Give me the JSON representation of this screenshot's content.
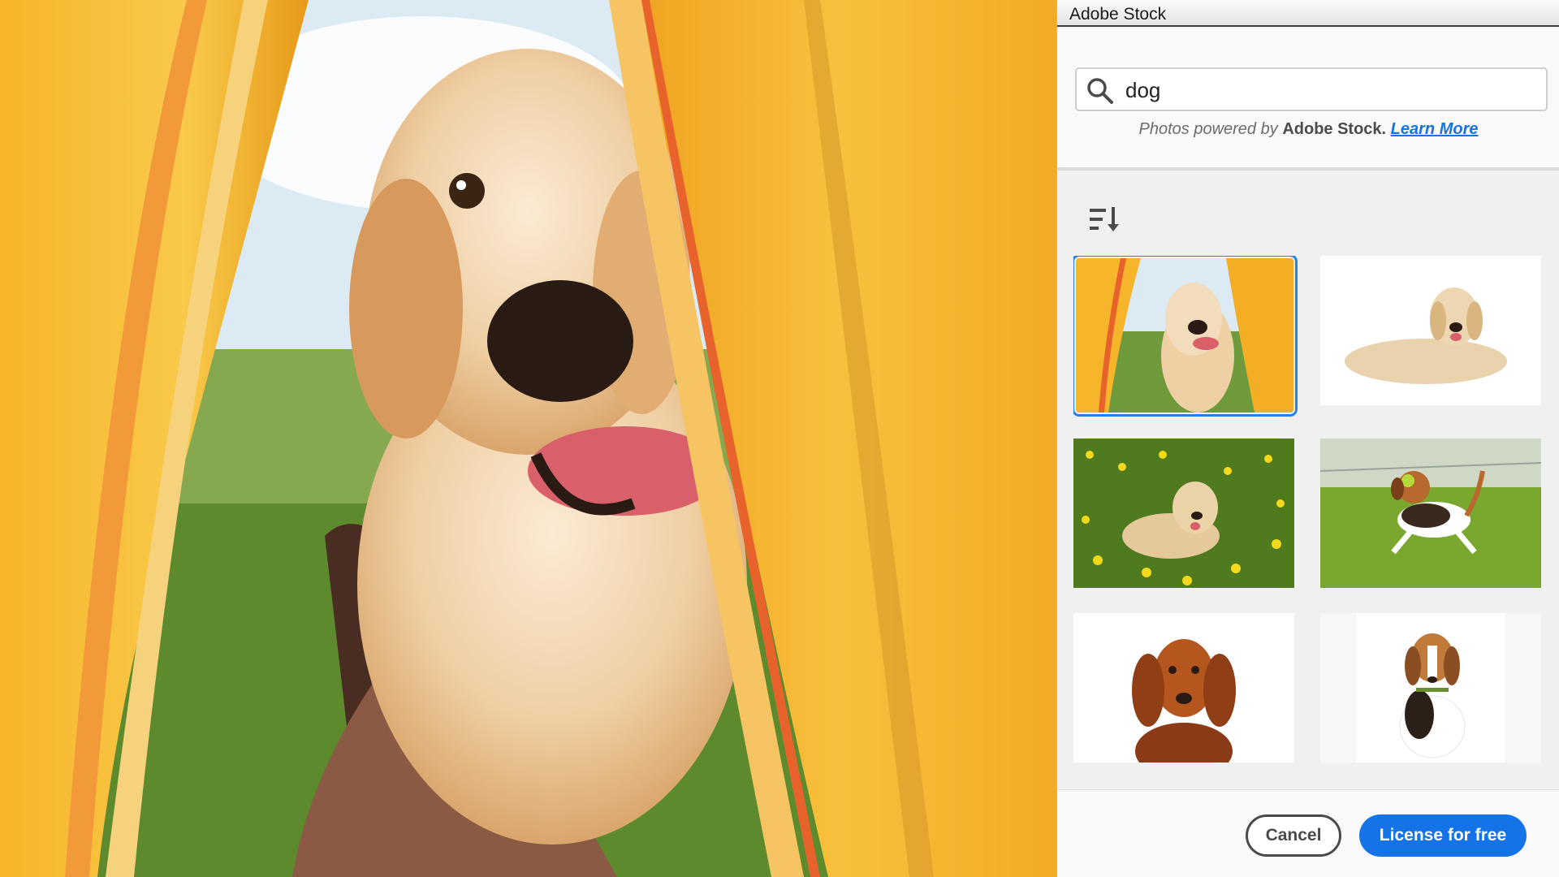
{
  "panel": {
    "title": "Adobe Stock",
    "search": {
      "value": "dog",
      "icon": "search-icon"
    },
    "powered_by": {
      "prefix": "Photos powered by",
      "brand": "Adobe Stock.",
      "link": "Learn More"
    },
    "sort_icon": "sort-icon",
    "results": [
      {
        "subject": "golden retriever peeking into yellow tent",
        "selected": true
      },
      {
        "subject": "golden retriever lying on white background",
        "selected": false
      },
      {
        "subject": "golden retriever in dandelion field",
        "selected": false
      },
      {
        "subject": "beagle running with tennis ball",
        "selected": false
      },
      {
        "subject": "irish setter portrait on white",
        "selected": false
      },
      {
        "subject": "beagle sitting on white",
        "selected": false
      }
    ],
    "footer": {
      "cancel_label": "Cancel",
      "license_label": "License for free"
    }
  },
  "colors": {
    "accent": "#1473e6",
    "selection": "#2680eb",
    "tent": "#f2a81d"
  }
}
